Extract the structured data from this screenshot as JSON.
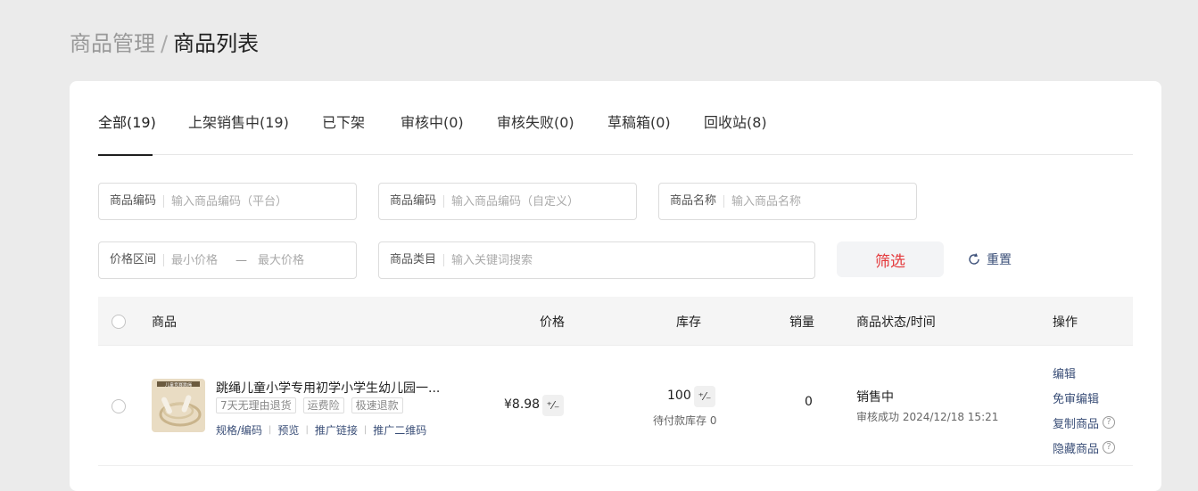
{
  "breadcrumb": {
    "parent": "商品管理",
    "separator": "/",
    "current": "商品列表"
  },
  "tabs": [
    {
      "label": "全部(19)",
      "active": true
    },
    {
      "label": "上架销售中(19)"
    },
    {
      "label": "已下架"
    },
    {
      "label": "审核中(0)"
    },
    {
      "label": "审核失败(0)"
    },
    {
      "label": "草稿箱(0)"
    },
    {
      "label": "回收站(8)"
    }
  ],
  "filters": {
    "code_platform": {
      "label": "商品编码",
      "placeholder": "输入商品编码（平台）"
    },
    "code_custom": {
      "label": "商品编码",
      "placeholder": "输入商品编码（自定义）"
    },
    "name": {
      "label": "商品名称",
      "placeholder": "输入商品名称"
    },
    "price_range": {
      "label": "价格区间",
      "min_placeholder": "最小价格",
      "dash": "—",
      "max_placeholder": "最大价格"
    },
    "category": {
      "label": "商品类目",
      "placeholder": "输入关键词搜索"
    },
    "filter_button": "筛选",
    "reset_button": "重置"
  },
  "table": {
    "columns": {
      "product": "商品",
      "price": "价格",
      "stock": "库存",
      "sales": "销量",
      "status": "商品状态/时间",
      "actions": "操作"
    },
    "rows": [
      {
        "title": "跳绳儿童小学专用初学小学生幼儿园一...",
        "thumb_text": "儿童竞赛跳绳",
        "tags": [
          "7天无理由退货",
          "运费险",
          "极速退款"
        ],
        "links": [
          "规格/编码",
          "预览",
          "推广链接",
          "推广二维码"
        ],
        "price": "¥8.98",
        "stock": "100",
        "stock_pending": "待付款库存 0",
        "sales": "0",
        "status": "销售中",
        "status_time": "审核成功 2024/12/18 15:21",
        "actions": [
          "编辑",
          "免审编辑",
          "复制商品",
          "隐藏商品"
        ],
        "edit_chip": "⁺⁄₋"
      }
    ]
  },
  "colors": {
    "accent_red": "#e4393c",
    "link_blue": "#3b4f78"
  }
}
